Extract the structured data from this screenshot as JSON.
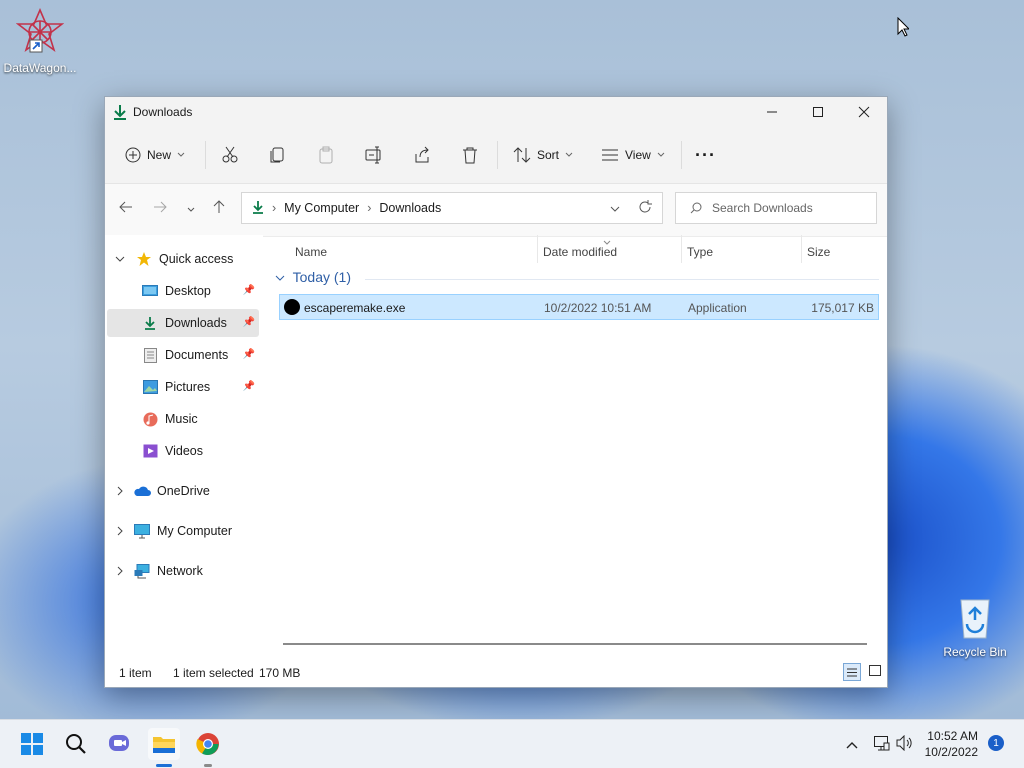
{
  "desktop": {
    "icons": [
      {
        "label": "DataWagon..."
      },
      {
        "label": "Recycle Bin"
      }
    ]
  },
  "window": {
    "title": "Downloads",
    "controls": {
      "minimize": "minimize",
      "maximize": "maximize",
      "close": "close"
    }
  },
  "toolbar": {
    "new_label": "New",
    "sort_label": "Sort",
    "view_label": "View",
    "more_label": "···"
  },
  "address": {
    "crumbs": [
      "My Computer",
      "Downloads"
    ],
    "search_placeholder": "Search Downloads"
  },
  "nav": {
    "quick_access": "Quick access",
    "items": [
      {
        "label": "Desktop",
        "icon": "desktop-icon",
        "pinned": true
      },
      {
        "label": "Downloads",
        "icon": "download-icon",
        "pinned": true,
        "selected": true
      },
      {
        "label": "Documents",
        "icon": "documents-icon",
        "pinned": true
      },
      {
        "label": "Pictures",
        "icon": "pictures-icon",
        "pinned": true
      },
      {
        "label": "Music",
        "icon": "music-icon",
        "pinned": false
      },
      {
        "label": "Videos",
        "icon": "videos-icon",
        "pinned": false
      }
    ],
    "roots": [
      {
        "label": "OneDrive",
        "icon": "onedrive-icon"
      },
      {
        "label": "My Computer",
        "icon": "computer-icon"
      },
      {
        "label": "Network",
        "icon": "network-icon"
      }
    ]
  },
  "files": {
    "columns": [
      "Name",
      "Date modified",
      "Type",
      "Size"
    ],
    "group": "Today (1)",
    "rows": [
      {
        "name": "escaperemake.exe",
        "date": "10/2/2022 10:51 AM",
        "type": "Application",
        "size": "175,017 KB"
      }
    ]
  },
  "status": {
    "count": "1 item",
    "selected": "1 item selected",
    "size": "170 MB"
  },
  "taskbar": {
    "time": "10:52 AM",
    "date": "10/2/2022",
    "notifications": "1"
  },
  "colors": {
    "accent": "#0a7c4a",
    "selection": "#cce8ff",
    "group": "#2f5fa6"
  }
}
